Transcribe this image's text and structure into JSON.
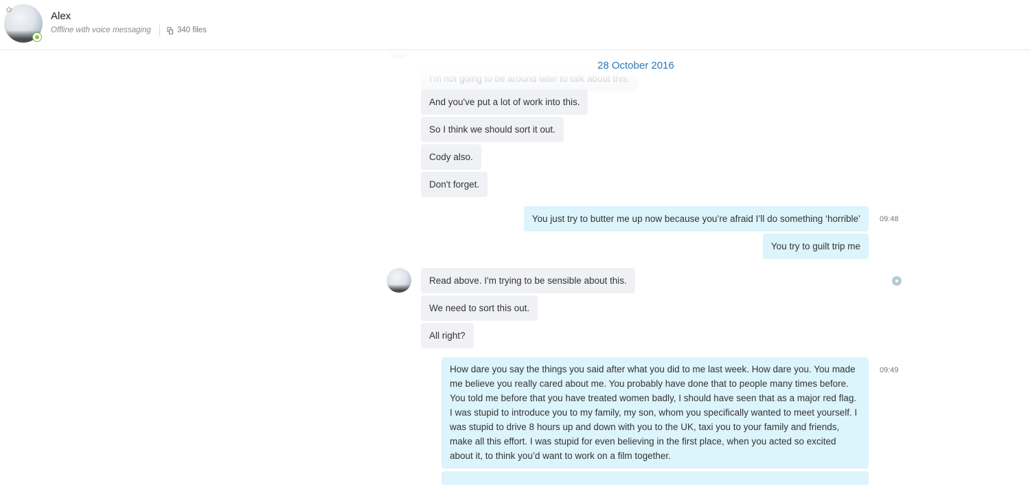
{
  "header": {
    "contact_name": "Alex",
    "status_text": "Offline with voice messaging",
    "files_text": "340 files",
    "favorite_icon": "star-icon",
    "status_icon": "online-status-icon",
    "files_icon": "files-icon"
  },
  "chat": {
    "date_label": "28 October 2016",
    "faded_message": "I'm not going to be around later to talk about this.",
    "messages_incoming_1": [
      "And you've put a lot of work into this.",
      "So I think we should sort it out.",
      "Cody also.",
      "Don't forget."
    ],
    "messages_outgoing_1": [
      "You just try to butter me up now because you’re afraid I’ll do something ‘horrible’",
      "You try to guilt trip me"
    ],
    "time_1": "09:48",
    "messages_incoming_2": [
      "Read above. I'm trying to be sensible about this.",
      "We need to sort this out.",
      "All right?"
    ],
    "long_message": "How dare you say the things you said after what you did to me last week. How dare you. You made me believe you really cared about me. You probably have done that to people many times before. You told me before that you have treated women badly, I should have seen that as a major red flag. I was stupid to introduce you to my family, my son, whom you specifically wanted to meet yourself. I was stupid to drive 8 hours up and down with you to the UK, taxi you to your family and friends, make all this effort. I was stupid for even believing in the first place, when you acted so excited about it, to think you’d want to work on a film together.",
    "time_2": "09:49"
  },
  "colors": {
    "incoming_bubble": "#f0f1f4",
    "outgoing_bubble": "#dcf4fb",
    "date_accent": "#2a77b5",
    "online_status": "#8bc34a"
  }
}
